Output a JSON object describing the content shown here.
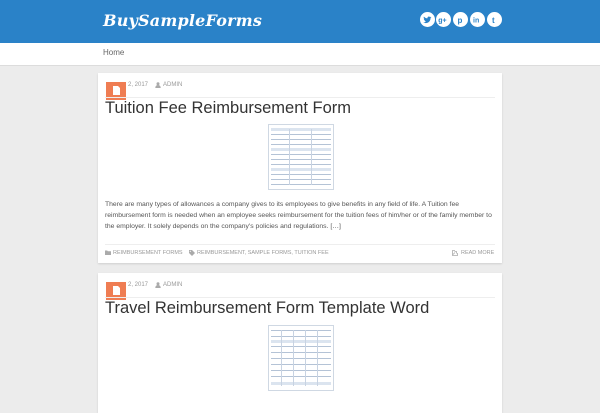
{
  "site": {
    "title": "BuySampleForms"
  },
  "social": [
    {
      "icon": "twitter-icon",
      "glyph": "t"
    },
    {
      "icon": "google-plus-icon",
      "glyph": "g+"
    },
    {
      "icon": "pinterest-icon",
      "glyph": "p"
    },
    {
      "icon": "linkedin-icon",
      "glyph": "in"
    },
    {
      "icon": "tumblr-icon",
      "glyph": "t"
    }
  ],
  "nav": {
    "home": "Home"
  },
  "posts": [
    {
      "date": "2, 2017",
      "author": "ADMIN",
      "title": "Tuition Fee Reimbursement Form",
      "excerpt": "There are many types of allowances a company gives to its employees to give benefits in any field of life. A Tuition fee reimbursement form is needed when an employee seeks reimbursement for the tuition fees of him/her or of the family member to the employer. It solely depends on the company's policies and regulations. […]",
      "category": "REIMBURSEMENT FORMS",
      "tags": "REIMBURSEMENT, SAMPLE FORMS, TUITION FEE",
      "read_more": "READ MORE"
    },
    {
      "date": "2, 2017",
      "author": "ADMIN",
      "title": "Travel Reimbursement Form Template Word"
    }
  ],
  "colors": {
    "header": "#2a82c8",
    "accent": "#ef7d53",
    "page_bg": "#ececec"
  }
}
